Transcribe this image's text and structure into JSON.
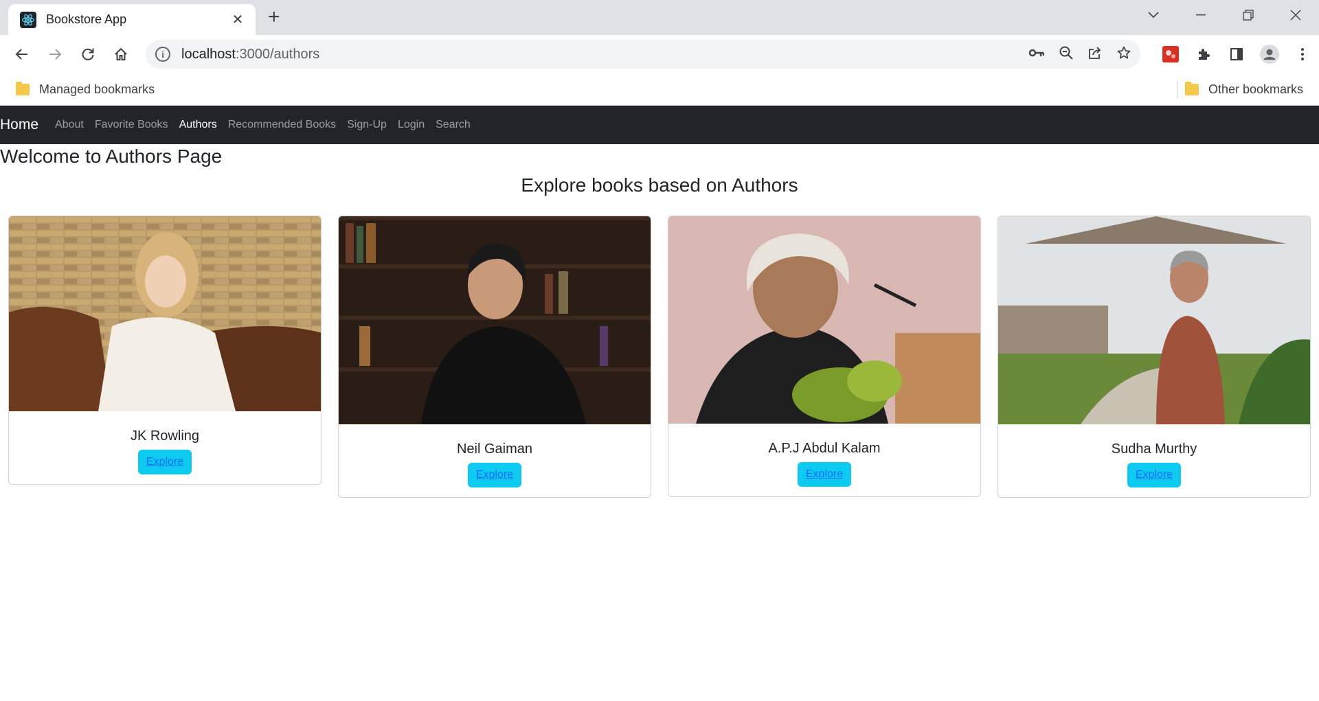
{
  "browser": {
    "tab_title": "Bookstore App",
    "url_host": "localhost",
    "url_path": ":3000/authors",
    "bookmarks": [
      "Managed bookmarks"
    ],
    "other_bookmarks": "Other bookmarks"
  },
  "navbar": {
    "brand": "Home",
    "links": [
      "About",
      "Favorite Books",
      "Authors",
      "Recommended Books",
      "Sign-Up",
      "Login",
      "Search"
    ],
    "active": "Authors"
  },
  "page": {
    "title": "Welcome to Authors Page",
    "subtitle": "Explore books based on Authors"
  },
  "authors": [
    {
      "name": "JK Rowling",
      "button": "Explore"
    },
    {
      "name": "Neil Gaiman",
      "button": "Explore"
    },
    {
      "name": "A.P.J Abdul Kalam",
      "button": "Explore"
    },
    {
      "name": "Sudha Murthy",
      "button": "Explore"
    }
  ],
  "colors": {
    "navbar_bg": "#212529",
    "button_bg": "#0dcaf0",
    "link": "#0d6efd"
  }
}
